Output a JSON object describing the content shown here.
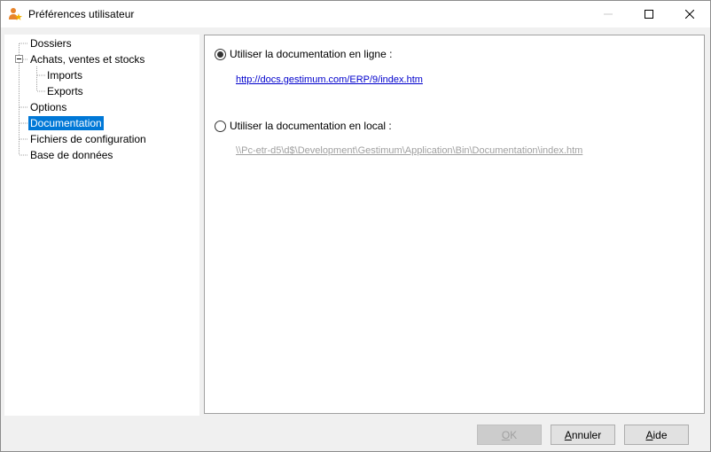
{
  "window": {
    "title": "Préférences utilisateur"
  },
  "tree": {
    "items": [
      {
        "label": "Dossiers"
      },
      {
        "label": "Achats, ventes et stocks"
      },
      {
        "label": "Imports"
      },
      {
        "label": "Exports"
      },
      {
        "label": "Options"
      },
      {
        "label": "Documentation"
      },
      {
        "label": "Fichiers de configuration"
      },
      {
        "label": "Base de données"
      }
    ],
    "selected": "Documentation"
  },
  "documentation": {
    "online_label": "Utiliser la documentation en ligne :",
    "online_url": "http://docs.gestimum.com/ERP/9/index.htm",
    "online_selected": true,
    "local_label": "Utiliser la documentation en local :",
    "local_path": "\\\\Pc-etr-d5\\d$\\Development\\Gestimum\\Application\\Bin\\Documentation\\index.htm",
    "local_selected": false
  },
  "buttons": {
    "ok": {
      "mnemonic": "O",
      "rest": "K",
      "enabled": false
    },
    "cancel": {
      "mnemonic": "A",
      "rest": "nnuler"
    },
    "help": {
      "mnemonic": "A",
      "rest": "ide"
    }
  },
  "colors": {
    "selection": "#0078d7",
    "link": "#0000cc",
    "disabled_text": "#a0a0a0"
  }
}
